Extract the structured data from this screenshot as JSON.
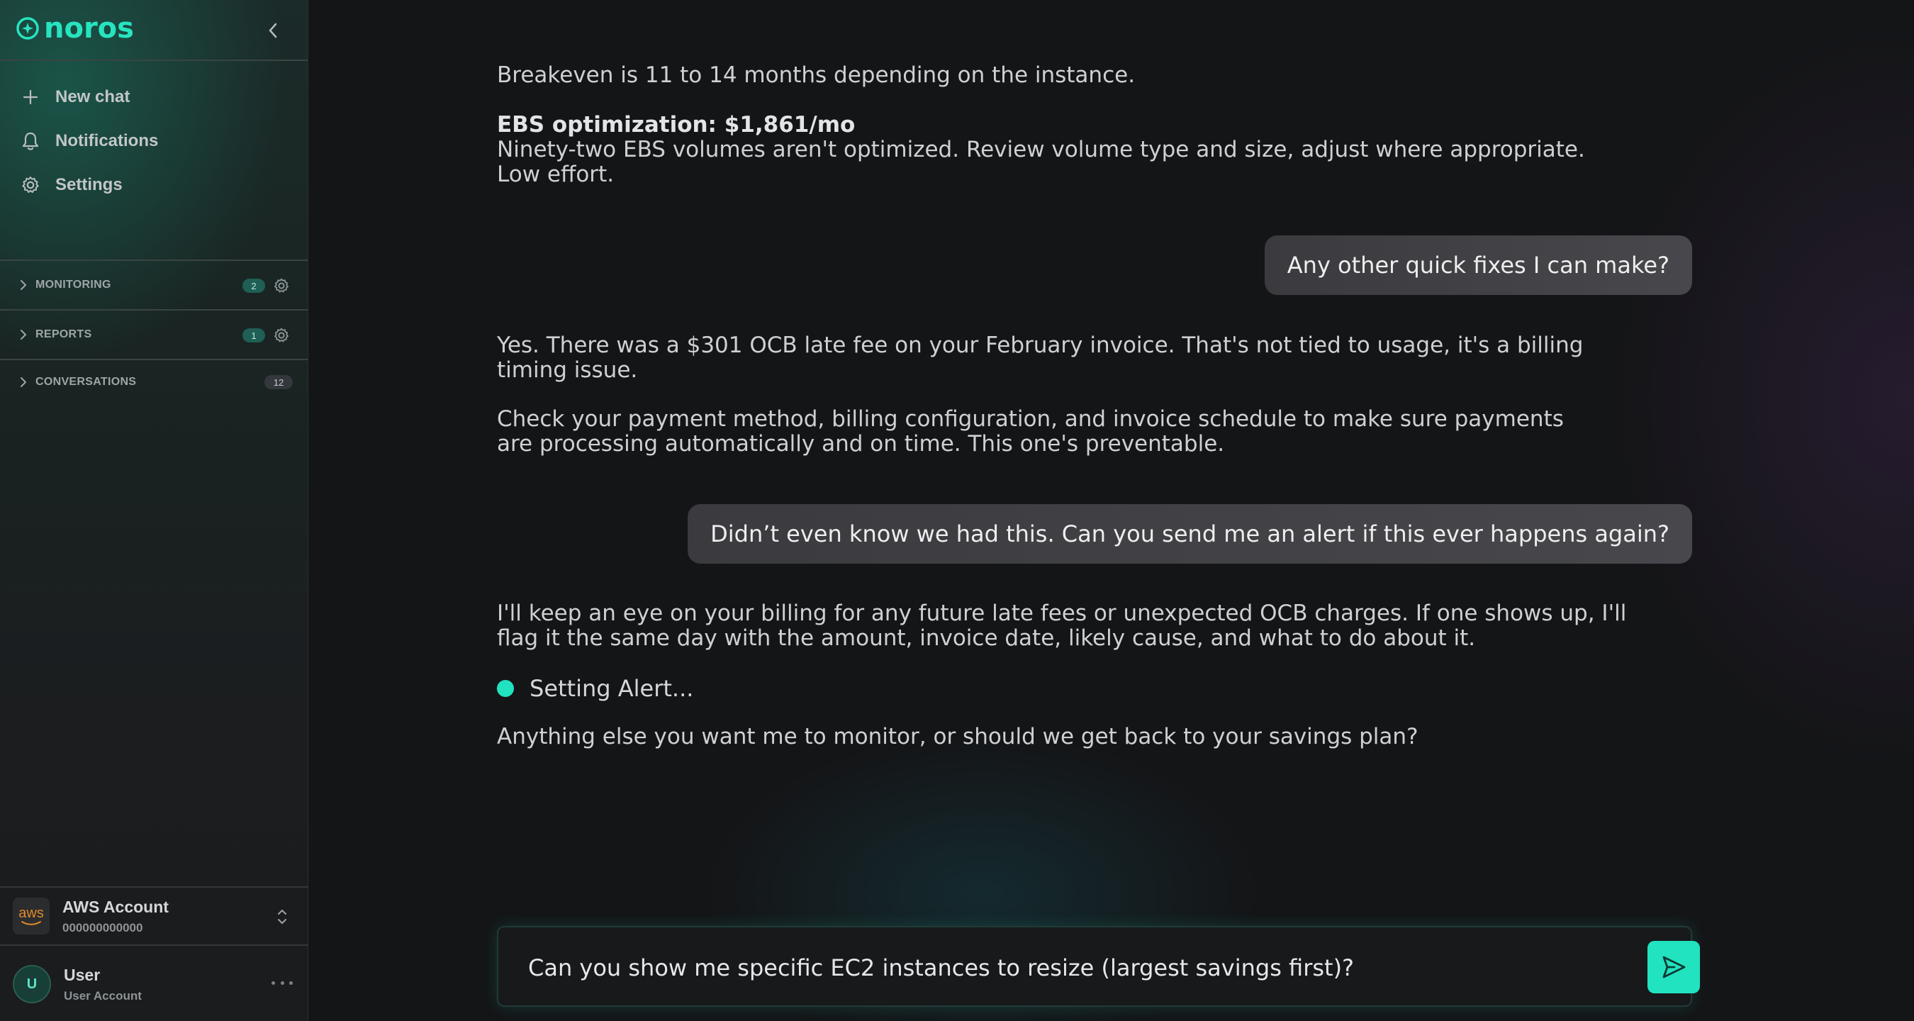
{
  "brand": {
    "name": "noros",
    "accent": "#22e3c0"
  },
  "sidebar": {
    "nav": [
      {
        "label": "New chat",
        "icon": "plus-icon"
      },
      {
        "label": "Notifications",
        "icon": "bell-icon"
      },
      {
        "label": "Settings",
        "icon": "gear-icon"
      }
    ],
    "sections": [
      {
        "label": "MONITORING",
        "count": "2"
      },
      {
        "label": "REPORTS",
        "count": "1"
      },
      {
        "label": "CONVERSATIONS",
        "count": "12"
      }
    ],
    "account": {
      "logo": "aws",
      "title": "AWS Account",
      "id": "000000000000"
    },
    "user": {
      "initial": "U",
      "name": "User",
      "role": "User Account"
    }
  },
  "chat": {
    "a1": "Breakeven is 11 to 14 months depending on the instance.",
    "a2_title": "EBS optimization: $1,861/mo",
    "a2_body": "Ninety-two EBS volumes aren't optimized. Review volume type and size, adjust where appropriate. Low effort.",
    "u1": "Any other quick fixes I can make?",
    "a3": "Yes. There was a $301 OCB late fee on your February invoice. That's not tied to usage, it's a billing timing issue.",
    "a4": "Check your payment method, billing configuration, and invoice schedule to make sure payments are processing automatically and on time. This one's preventable.",
    "u2": "Didn’t even know we had this. Can you send me an alert if this ever happens again?",
    "a5": "I'll keep an eye on your billing for any future late fees or unexpected OCB charges. If one shows up, I'll flag it the same day with the amount, invoice date, likely cause, and what to do about it.",
    "status": "Setting Alert...",
    "a6": "Anything else you want me to monitor, or should we get back to your savings plan?"
  },
  "composer": {
    "value": "Can you show me specific EC2 instances to resize (largest savings first)?"
  }
}
